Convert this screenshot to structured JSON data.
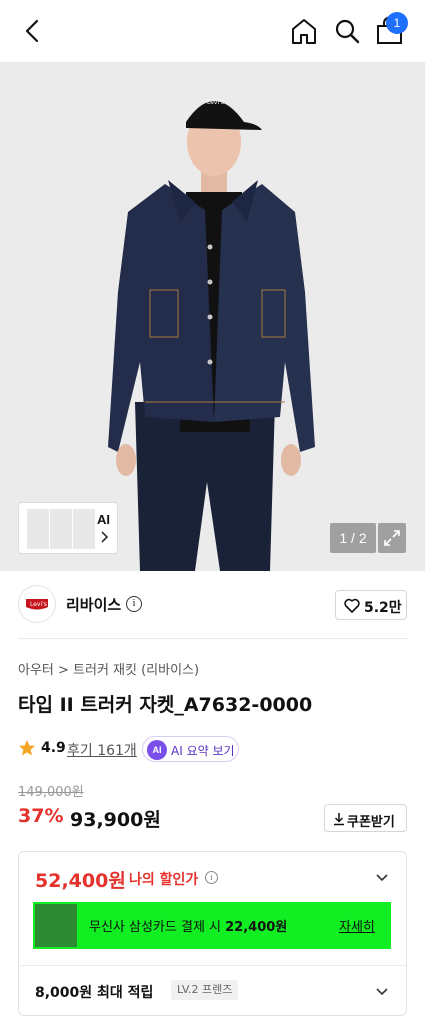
{
  "header": {
    "back_icon": "chevron-left-icon",
    "home_icon": "home-icon",
    "search_icon": "search-icon",
    "cart_icon": "shopping-bag-icon",
    "cart_count": "1",
    "badge_color": "#1f6fff"
  },
  "gallery": {
    "thumb_ai_label": "AI",
    "pager": "1 / 2",
    "expand_icon": "expand-icon"
  },
  "brand": {
    "logo_text": "Levi's",
    "name": "리바이스",
    "like_count": "5.2만"
  },
  "product": {
    "breadcrumb": "아우터 > 트러커 재킷 (리바이스)",
    "title": "타입 II 트러커 자켓_A7632-0000",
    "rating": "4.9",
    "reviews": "후기 161개",
    "ai_badge": "AI",
    "ai_summary": "AI 요약 보기"
  },
  "price": {
    "original": "149,000원",
    "discount": "37%",
    "sale": "93,900원",
    "coupon_label": "쿠폰받기",
    "accent_color": "#e5322d"
  },
  "benefit": {
    "my_price": "52,400원",
    "my_price_label": "나의 할인가",
    "promo_prefix": "무신사 삼성카드 결제 시 ",
    "promo_amount": "22,400원",
    "promo_more": "자세히",
    "promo_color": "#11ee22",
    "points": "8,000원 최대 적립",
    "level": "LV.2 프렌즈"
  }
}
